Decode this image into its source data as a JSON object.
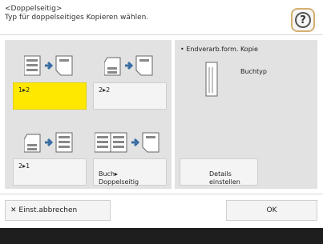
{
  "header": {
    "line1": "<Doppelseitig>",
    "line2": "Typ für doppelseitiges Kopieren wählen."
  },
  "help": {
    "label": "?"
  },
  "options": [
    {
      "label": "1▸2",
      "selected": true
    },
    {
      "label": "2▸2",
      "selected": false
    },
    {
      "label": "2▸1",
      "selected": false
    },
    {
      "label": "Buch▸\nDoppelseitig",
      "selected": false
    }
  ],
  "finished": {
    "title": "• Endverarb.form. Kopie",
    "value": "Buchtyp"
  },
  "details": {
    "label": "Details\neinstellen"
  },
  "footer": {
    "cancel": "✕ Einst.abbrechen",
    "ok": "OK"
  },
  "colors": {
    "selected": "#ffe800",
    "accent": "#d4b070"
  }
}
